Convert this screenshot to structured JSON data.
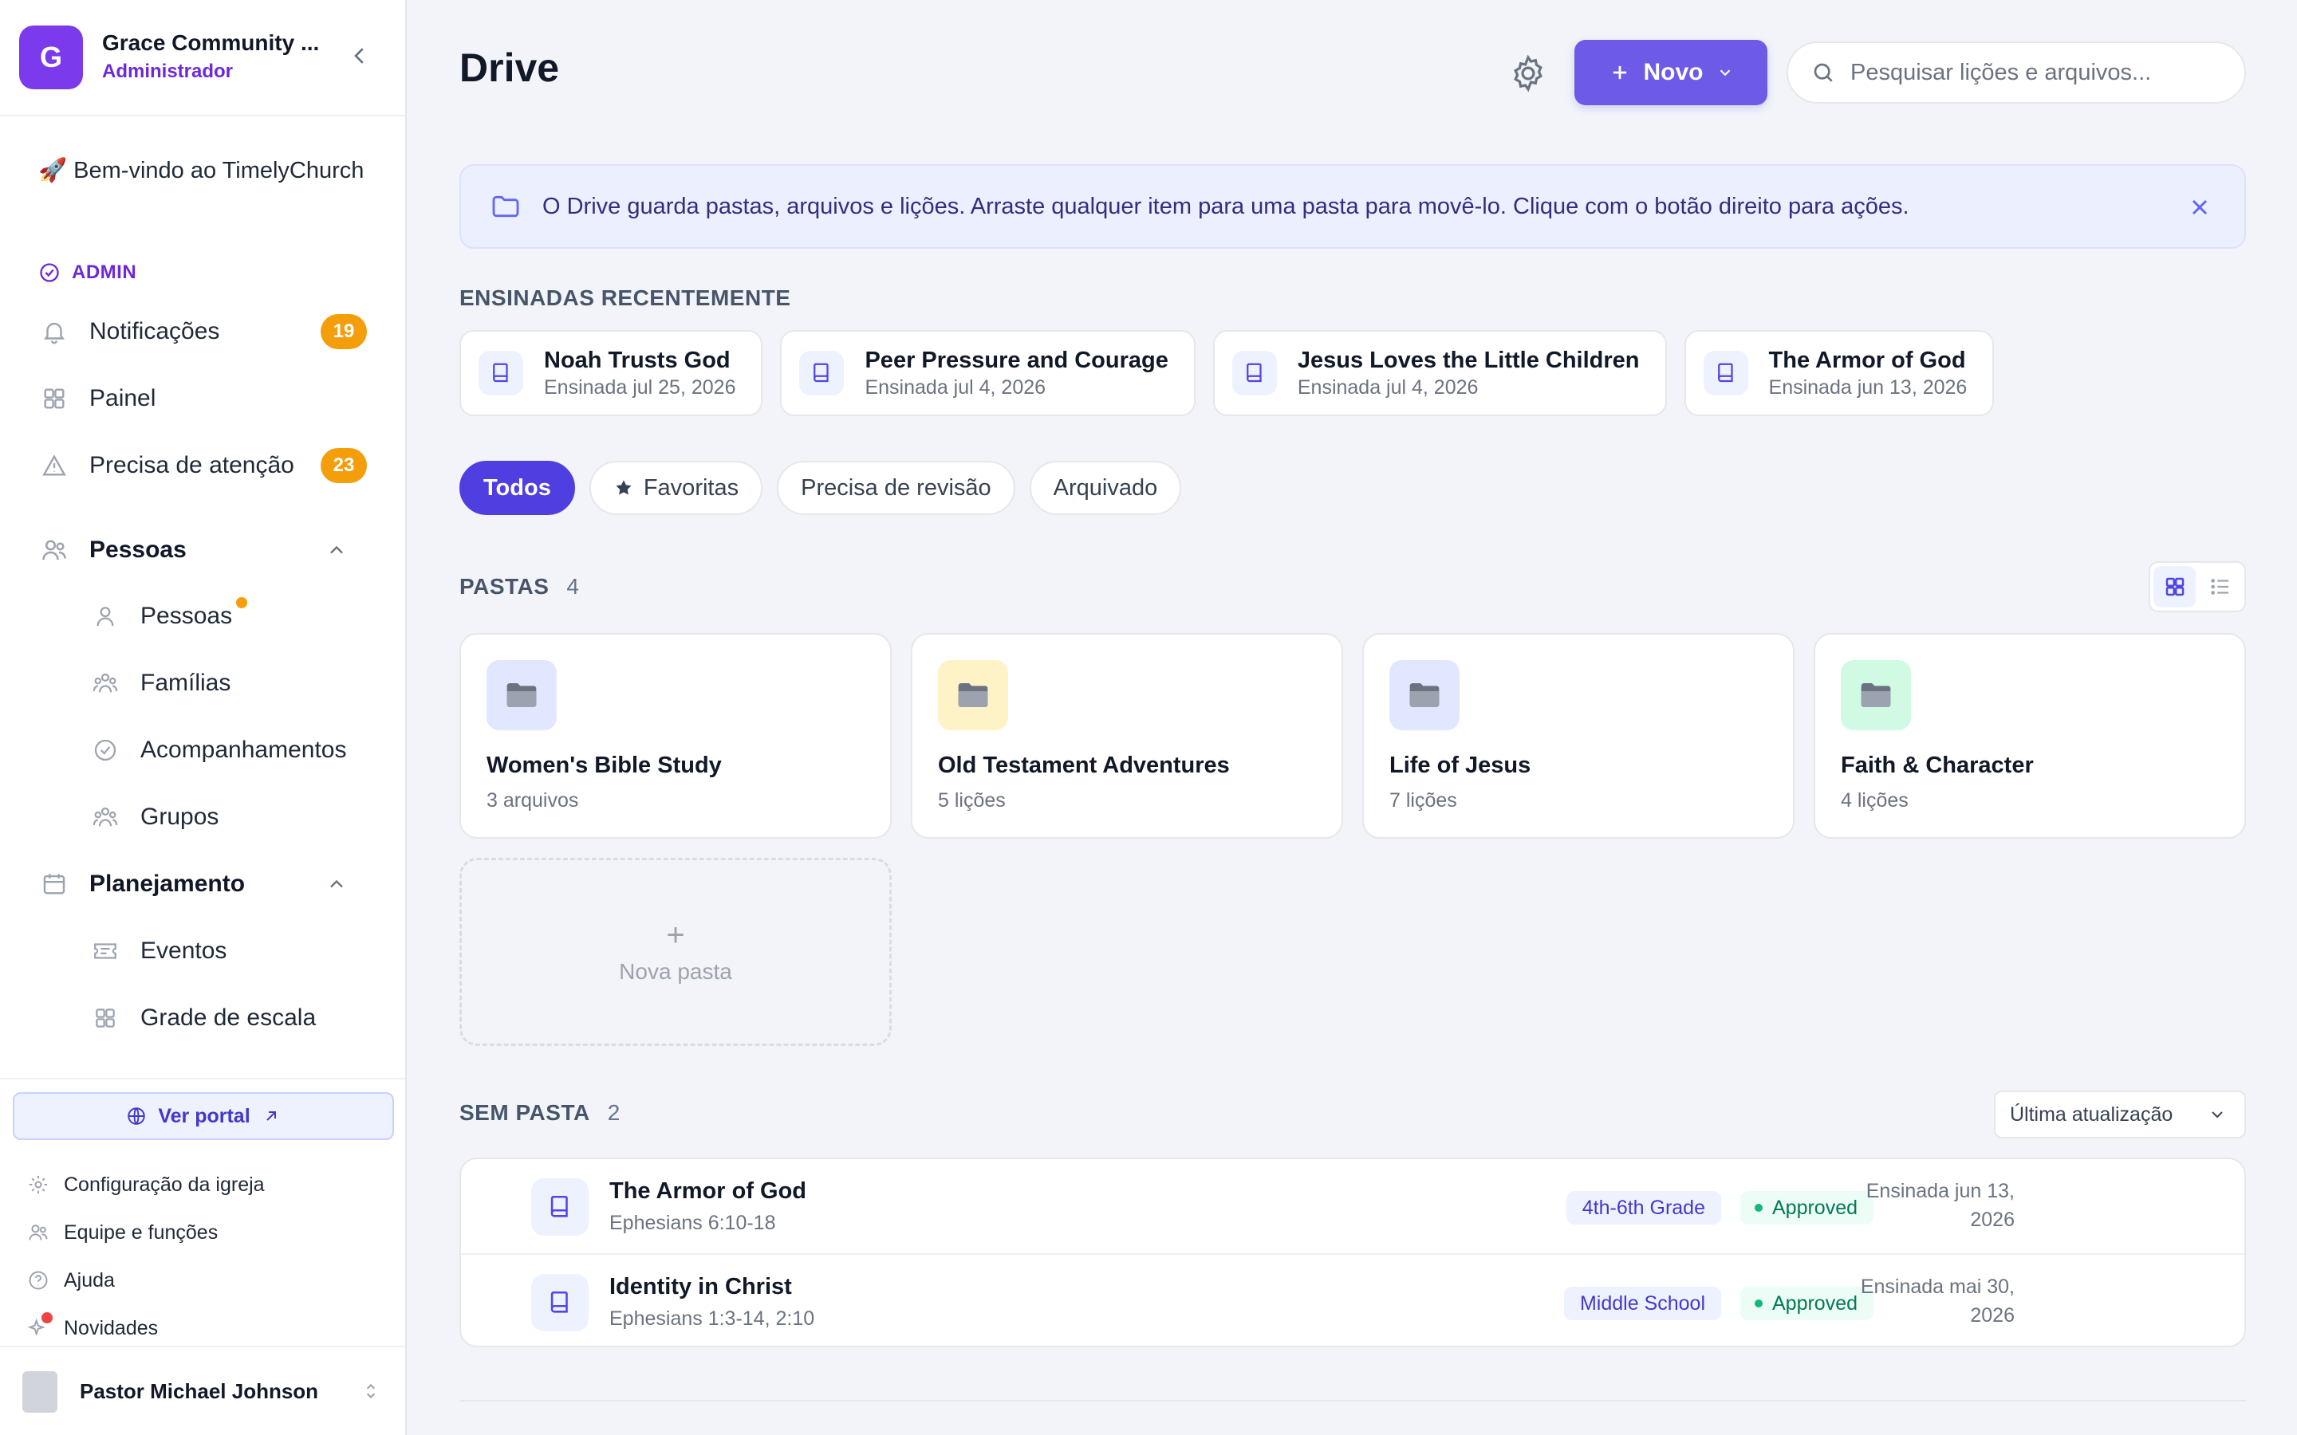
{
  "sidebar": {
    "org": {
      "initial": "G",
      "name": "Grace Community ...",
      "role": "Administrador"
    },
    "welcome": "🚀 Bem-vindo ao TimelyChurch",
    "admin_label": "ADMIN",
    "nav": {
      "notifications": {
        "label": "Notificações",
        "badge": "19"
      },
      "dashboard": {
        "label": "Painel"
      },
      "attention": {
        "label": "Precisa de atenção",
        "badge": "23"
      },
      "people_section": {
        "label": "Pessoas"
      },
      "people": {
        "label": "Pessoas"
      },
      "families": {
        "label": "Famílias"
      },
      "followups": {
        "label": "Acompanhamentos"
      },
      "groups": {
        "label": "Grupos"
      },
      "planning_section": {
        "label": "Planejamento"
      },
      "events": {
        "label": "Eventos"
      },
      "schedule": {
        "label": "Grade de escala"
      }
    },
    "portal_label": "Ver portal",
    "footer_links": {
      "church_config": "Configuração da igreja",
      "team": "Equipe e funções",
      "help": "Ajuda",
      "news": "Novidades"
    },
    "user": {
      "name": "Pastor Michael Johnson"
    }
  },
  "header": {
    "title": "Drive",
    "new_label": "Novo",
    "search_placeholder": "Pesquisar lições e arquivos..."
  },
  "banner": {
    "text": "O Drive guarda pastas, arquivos e lições. Arraste qualquer item para uma pasta para movê-lo. Clique com o botão direito para ações."
  },
  "recent": {
    "heading": "ENSINADAS RECENTEMENTE",
    "items": [
      {
        "title": "Noah Trusts God",
        "sub": "Ensinada jul 25, 2026"
      },
      {
        "title": "Peer Pressure and Courage",
        "sub": "Ensinada jul 4, 2026"
      },
      {
        "title": "Jesus Loves the Little Children",
        "sub": "Ensinada jul 4, 2026"
      },
      {
        "title": "The Armor of God",
        "sub": "Ensinada jun 13, 2026"
      }
    ]
  },
  "filters": [
    "Todos",
    "Favoritas",
    "Precisa de revisão",
    "Arquivado"
  ],
  "folders": {
    "heading": "PASTAS",
    "count": "4",
    "items": [
      {
        "name": "Women's Bible Study",
        "count": "3 arquivos",
        "tint": "#e0e7ff"
      },
      {
        "name": "Old Testament Adventures",
        "count": "5 lições",
        "tint": "#fef3c7"
      },
      {
        "name": "Life of Jesus",
        "count": "7 lições",
        "tint": "#e0e7ff"
      },
      {
        "name": "Faith & Character",
        "count": "4 lições",
        "tint": "#d1fae5"
      }
    ],
    "new_label": "Nova pasta"
  },
  "unfiled": {
    "heading": "SEM PASTA",
    "count": "2",
    "sort_label": "Última atualização",
    "rows": [
      {
        "title": "The Armor of God",
        "ref": "Ephesians 6:10-18",
        "grade": "4th-6th Grade",
        "status": "Approved",
        "date_line1": "Ensinada jun 13,",
        "date_line2": "2026"
      },
      {
        "title": "Identity in Christ",
        "ref": "Ephesians 1:3-14, 2:10",
        "grade": "Middle School",
        "status": "Approved",
        "date_line1": "Ensinada mai 30,",
        "date_line2": "2026"
      }
    ]
  },
  "colors": {
    "accent": "#4f3fe0",
    "badge": "#f59e0b",
    "approved": "#047857"
  }
}
